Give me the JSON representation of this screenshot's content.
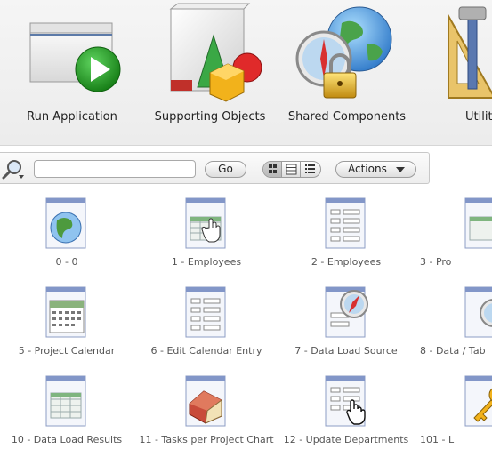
{
  "components": [
    {
      "label": "Run Application",
      "icon": "run-application-icon"
    },
    {
      "label": "Supporting Objects",
      "icon": "supporting-objects-icon"
    },
    {
      "label": "Shared Components",
      "icon": "shared-components-icon"
    },
    {
      "label": "Utiliti",
      "icon": "utilities-icon"
    }
  ],
  "toolbar": {
    "search_value": "",
    "go_label": "Go",
    "actions_label": "Actions",
    "view_modes": [
      "icons",
      "report",
      "details"
    ],
    "selected_view": "icons"
  },
  "pages": [
    {
      "label": "0 - 0",
      "icon": "globe-page-icon"
    },
    {
      "label": "1 - Employees",
      "icon": "grid-page-icon"
    },
    {
      "label": "2 - Employees",
      "icon": "form-page-icon"
    },
    {
      "label": "3 - Pro",
      "icon": "grid-page-icon"
    },
    {
      "label": "5 - Project Calendar",
      "icon": "calendar-page-icon"
    },
    {
      "label": "6 - Edit Calendar Entry",
      "icon": "form-page-icon"
    },
    {
      "label": "7 - Data Load Source",
      "icon": "compass-page-icon"
    },
    {
      "label": "8 - Data / Tab",
      "icon": "compass-page-icon"
    },
    {
      "label": "10 - Data Load Results",
      "icon": "grid-page-icon"
    },
    {
      "label": "11 - Tasks per Project Chart",
      "icon": "chart-page-icon"
    },
    {
      "label": "12 - Update Departments",
      "icon": "form-page-icon"
    },
    {
      "label": "101 - L",
      "icon": "login-page-icon"
    }
  ],
  "colors": {
    "accent_green": "#2aa02a",
    "page_blue": "#6f83b8"
  }
}
